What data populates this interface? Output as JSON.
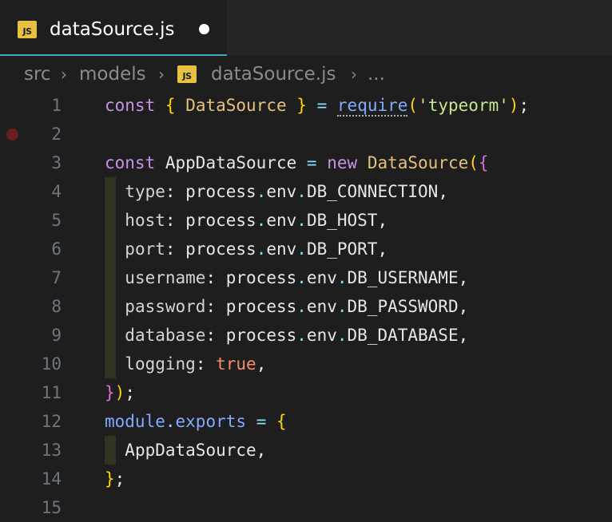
{
  "tab": {
    "badge": "JS",
    "title": "dataSource.js"
  },
  "breadcrumb": {
    "segments": [
      "src",
      "models",
      "dataSource.js",
      "..."
    ],
    "badge": "JS"
  },
  "editor": {
    "line_numbers": [
      "1",
      "2",
      "3",
      "4",
      "5",
      "6",
      "7",
      "8",
      "9",
      "10",
      "11",
      "12",
      "13",
      "14",
      "15"
    ],
    "line1": {
      "const": "const",
      "obrace": "{",
      "cls": "DataSource",
      "cbrace": "}",
      "eq": "=",
      "require": "require",
      "oparen": "(",
      "str": "'typeorm'",
      "cparen": ")",
      "semi": ";"
    },
    "line3": {
      "const": "const",
      "name": "AppDataSource",
      "eq": "=",
      "new": "new",
      "cls": "DataSource",
      "oparen": "(",
      "obrace": "{"
    },
    "props": [
      {
        "key": "type",
        "obj": "process",
        "env": "env",
        "val": "DB_CONNECTION"
      },
      {
        "key": "host",
        "obj": "process",
        "env": "env",
        "val": "DB_HOST"
      },
      {
        "key": "port",
        "obj": "process",
        "env": "env",
        "val": "DB_PORT"
      },
      {
        "key": "username",
        "obj": "process",
        "env": "env",
        "val": "DB_USERNAME"
      },
      {
        "key": "password",
        "obj": "process",
        "env": "env",
        "val": "DB_PASSWORD"
      },
      {
        "key": "database",
        "obj": "process",
        "env": "env",
        "val": "DB_DATABASE"
      }
    ],
    "line10": {
      "key": "logging",
      "val": "true"
    },
    "line11": {
      "cbrace": "}",
      "cparen": ")",
      "semi": ";"
    },
    "line12": {
      "module": "module",
      "exports": "exports",
      "eq": "=",
      "obrace": "{"
    },
    "line13": {
      "name": "AppDataSource"
    },
    "line14": {
      "cbrace": "}",
      "semi": ";"
    }
  },
  "colors": {
    "background": "#1e1e1e",
    "keyword": "#c792ea",
    "class": "#e5c07b",
    "string": "#c3e88d",
    "tab_accent": "#3ea8b5"
  }
}
